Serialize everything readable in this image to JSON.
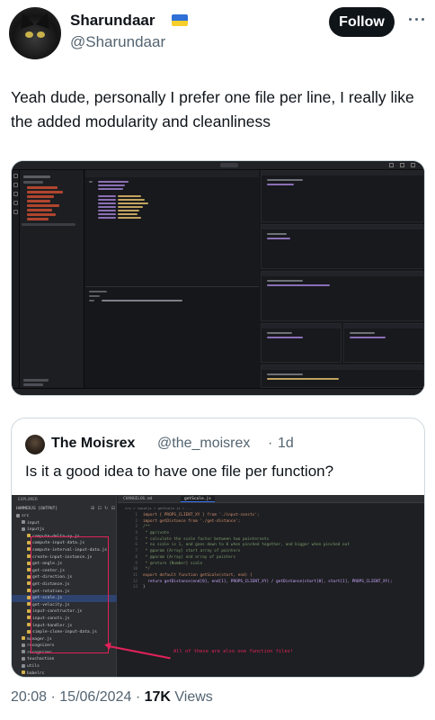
{
  "author": {
    "display_name": "Sharundaar",
    "handle": "@Sharundaar",
    "follow_label": "Follow"
  },
  "tweet": {
    "text": "Yeah dude, personally I prefer one file per line, I really like the added modularity and cleanliness"
  },
  "quoted": {
    "display_name": "The Moisrex",
    "handle": "@the_moisrex",
    "separator": "·",
    "age": "1d",
    "text": "Is it a good idea to have one file per function?",
    "ide": {
      "explorer_header": "EXPLORER",
      "project": "HAMMERJS [OUTPUT]",
      "tabs": [
        "CHANGELOG.md",
        "getScale.js"
      ],
      "breadcrumb": "src > inputjs > getScale.js > ...",
      "tree": [
        {
          "label": "src",
          "kind": "dir",
          "indent": 0
        },
        {
          "label": "input",
          "kind": "dir",
          "indent": 1
        },
        {
          "label": "inputjs",
          "kind": "dir",
          "indent": 1
        },
        {
          "label": "compute-delta-xy.js",
          "kind": "file",
          "indent": 2
        },
        {
          "label": "compute-input-data.js",
          "kind": "file",
          "indent": 2
        },
        {
          "label": "compute-interval-input-data.js",
          "kind": "file",
          "indent": 2
        },
        {
          "label": "create-input-instance.js",
          "kind": "file",
          "indent": 2
        },
        {
          "label": "get-angle.js",
          "kind": "file",
          "indent": 2
        },
        {
          "label": "get-center.js",
          "kind": "file",
          "indent": 2
        },
        {
          "label": "get-direction.js",
          "kind": "file",
          "indent": 2
        },
        {
          "label": "get-distance.js",
          "kind": "file",
          "indent": 2
        },
        {
          "label": "get-rotation.js",
          "kind": "file",
          "indent": 2
        },
        {
          "label": "get-scale.js",
          "kind": "file",
          "indent": 2,
          "selected": true
        },
        {
          "label": "get-velocity.js",
          "kind": "file",
          "indent": 2
        },
        {
          "label": "input-constructor.js",
          "kind": "file",
          "indent": 2
        },
        {
          "label": "input-consts.js",
          "kind": "file",
          "indent": 2
        },
        {
          "label": "input-handler.js",
          "kind": "file",
          "indent": 2
        },
        {
          "label": "simple-clone-input-data.js",
          "kind": "file",
          "indent": 2
        },
        {
          "label": "manager.js",
          "kind": "file",
          "indent": 1
        },
        {
          "label": "recognizers",
          "kind": "dir",
          "indent": 1
        },
        {
          "label": "recognizer",
          "kind": "dir",
          "indent": 1
        },
        {
          "label": "touchaction",
          "kind": "dir",
          "indent": 1
        },
        {
          "label": "utils",
          "kind": "dir",
          "indent": 1
        },
        {
          "label": "babelrc",
          "kind": "file",
          "indent": 1
        },
        {
          "label": "hammer.js",
          "kind": "file",
          "indent": 1
        }
      ],
      "line_numbers": [
        "1",
        "2",
        "3",
        "4",
        "5",
        "6",
        "7",
        "8",
        "9",
        "10",
        "11",
        "12",
        "13"
      ],
      "code_lines": [
        "import { PROPS_CLIENT_XY } from './input-consts';",
        "import getDistance from './get-distance';",
        "/**",
        " * @private",
        " * calculate the scale factor between two pointersets",
        " * no scale is 1, and goes down to 0 when pinched together, and bigger when pinched out",
        " * @param {Array} start array of pointers",
        " * @param {Array} end array of pointers",
        " * @return {Number} scale",
        " */",
        "export default function getScale(start, end) {",
        "  return getDistance(end[0], end[1], PROPS_CLIENT_XY) / getDistance(start[0], start[1], PROPS_CLIENT_XY);",
        "}"
      ],
      "annotation": "All of these are also one function files!"
    }
  },
  "footer": {
    "time": "20:08",
    "separator": "·",
    "date": "15/06/2024",
    "separator2": "·",
    "views_count": "17K",
    "views_label": "Views"
  },
  "colors": {
    "follow_bg": "#0f1419",
    "muted": "#536471",
    "annotation": "#e0225a",
    "ide_bg": "#1e1f22"
  }
}
